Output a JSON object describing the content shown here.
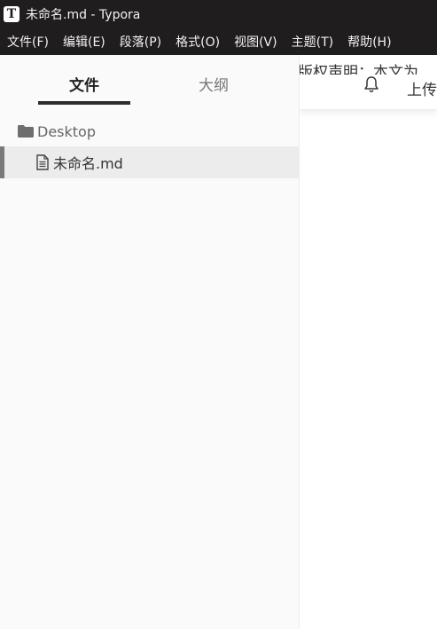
{
  "window": {
    "app_icon_letter": "T",
    "title": "未命名.md - Typora"
  },
  "menubar": {
    "items": [
      {
        "label": "文件(F)"
      },
      {
        "label": "编辑(E)"
      },
      {
        "label": "段落(P)"
      },
      {
        "label": "格式(O)"
      },
      {
        "label": "视图(V)"
      },
      {
        "label": "主题(T)"
      },
      {
        "label": "帮助(H)"
      }
    ]
  },
  "sidebar": {
    "tabs": {
      "files": "文件",
      "outline": "大纲",
      "active": "files"
    },
    "folder": {
      "label": "Desktop",
      "icon": "folder-icon"
    },
    "files": [
      {
        "label": "未命名.md",
        "icon": "file-text-icon",
        "active": true
      }
    ]
  },
  "editor": {
    "topbar": {
      "copyright_text": "版权声明：本文为",
      "bell_icon": "bell-icon",
      "upload_label": "上传"
    }
  },
  "colors": {
    "titlebar_bg": "#201d1f",
    "sidebar_bg": "#fafafa",
    "active_row_bg": "#ececec",
    "tab_indicator": "#2d2d2d"
  }
}
